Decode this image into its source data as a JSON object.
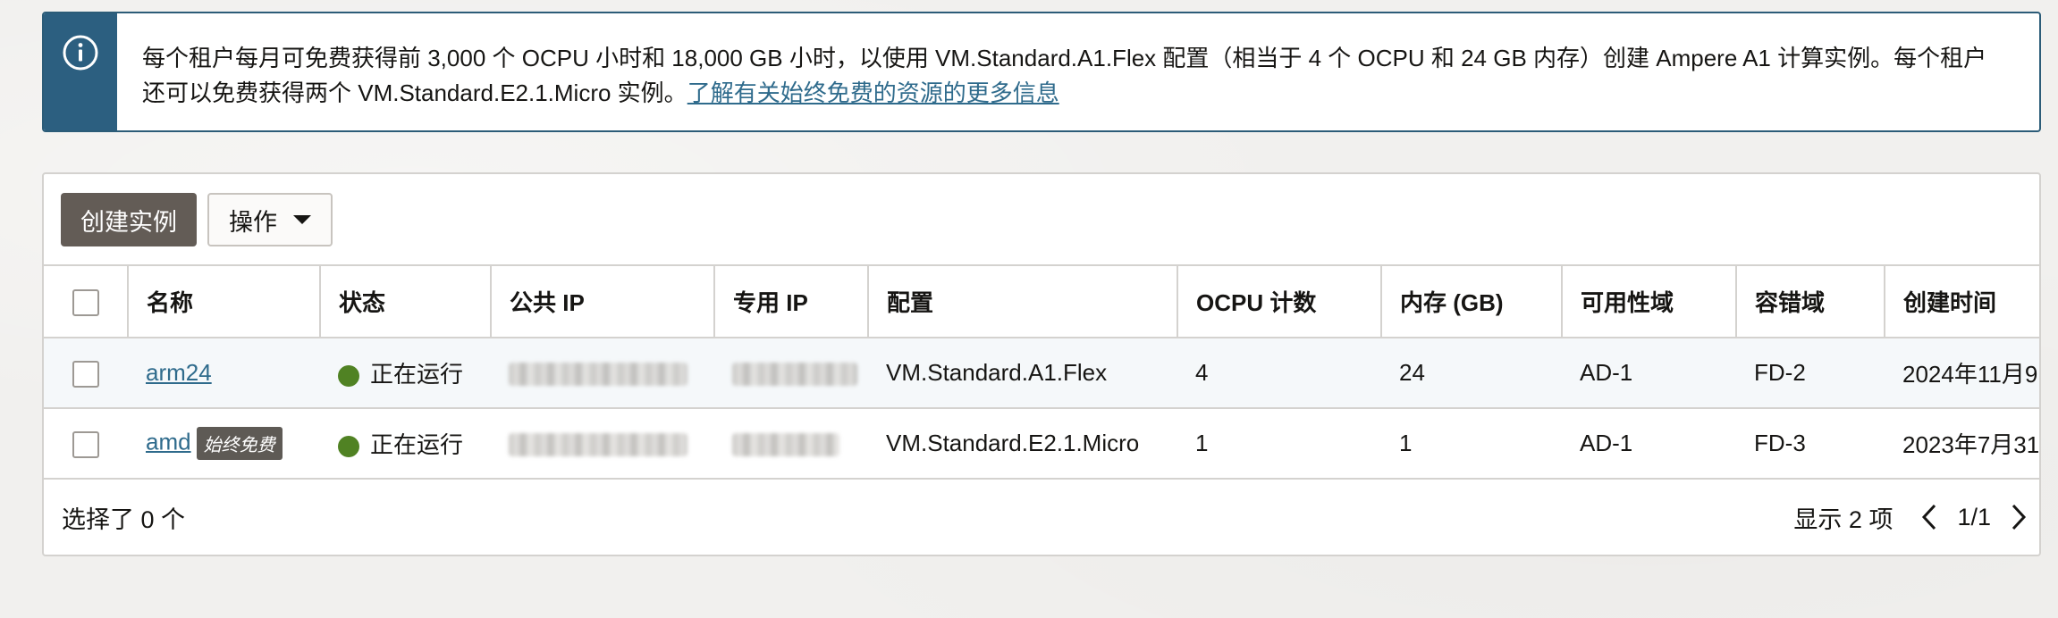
{
  "banner": {
    "text": "每个租户每月可免费获得前 3,000 个 OCPU 小时和 18,000 GB 小时，以使用 VM.Standard.A1.Flex 配置（相当于 4 个 OCPU 和 24 GB 内存）创建 Ampere A1 计算实例。每个租户还可以免费获得两个 VM.Standard.E2.1.Micro 实例。",
    "link": "了解有关始终免费的资源的更多信息",
    "icon": "info-icon"
  },
  "toolbar": {
    "create_label": "创建实例",
    "actions_label": "操作"
  },
  "table": {
    "headers": [
      "名称",
      "状态",
      "公共 IP",
      "专用 IP",
      "配置",
      "OCPU 计数",
      "内存 (GB)",
      "可用性域",
      "容错域",
      "创建时间"
    ],
    "rows": [
      {
        "name": "arm24",
        "badge": "",
        "status": "正在运行",
        "shape": "VM.Standard.A1.Flex",
        "ocpu": "4",
        "memory": "24",
        "ad": "AD-1",
        "fd": "FD-2",
        "created": "2024年11月9"
      },
      {
        "name": "amd",
        "badge": "始终免费",
        "status": "正在运行",
        "shape": "VM.Standard.E2.1.Micro",
        "ocpu": "1",
        "memory": "1",
        "ad": "AD-1",
        "fd": "FD-3",
        "created": "2023年7月31"
      }
    ]
  },
  "footer": {
    "selected": "选择了 0 个",
    "showing": "显示 2 项",
    "page": "1/1"
  },
  "colors": {
    "banner_side": "#2c5f80",
    "link": "#2f6b8c",
    "primary_button": "#635c56",
    "status_running": "#508223",
    "badge": "#5e5a55"
  }
}
